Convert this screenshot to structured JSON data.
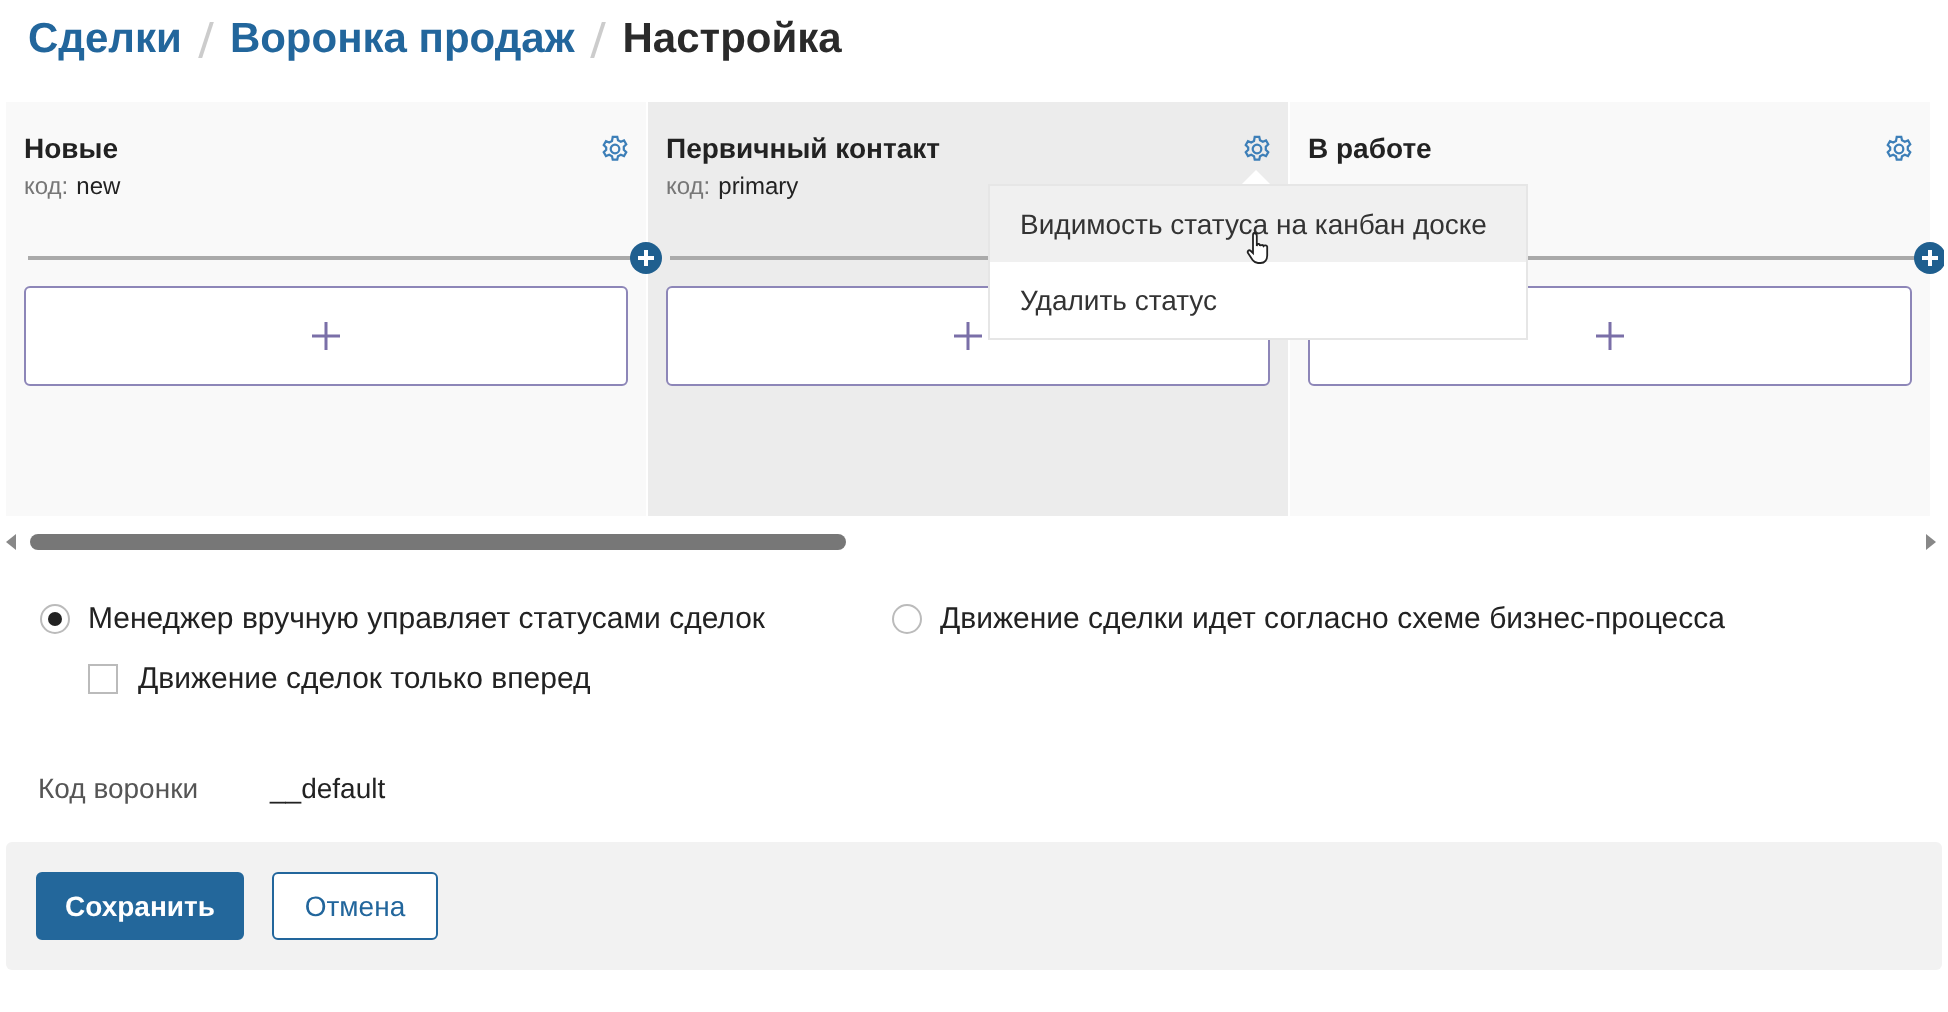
{
  "breadcrumb": [
    {
      "label": "Сделки",
      "kind": "link"
    },
    {
      "label": "Воронка продаж",
      "kind": "link"
    },
    {
      "label": "Настройка",
      "kind": "current"
    }
  ],
  "columns": [
    {
      "title": "Новые",
      "code_label": "код:",
      "code": "new",
      "highlighted": false
    },
    {
      "title": "Первичный контакт",
      "code_label": "код:",
      "code": "primary",
      "highlighted": true,
      "context_menu": {
        "items": [
          {
            "label": "Видимость статуса на канбан доске",
            "hovered": true
          },
          {
            "label": "Удалить статус",
            "hovered": false
          }
        ]
      }
    },
    {
      "title": "В работе",
      "highlighted": false
    }
  ],
  "mode_options": [
    {
      "label": "Менеджер вручную управляет статусами сделок",
      "selected": true
    },
    {
      "label": "Движение сделки идет согласно схеме бизнес-процесса",
      "selected": false
    }
  ],
  "forward_only": {
    "label": "Движение сделок только вперед",
    "checked": false
  },
  "funnel_code": {
    "label": "Код воронки",
    "value": "__default"
  },
  "buttons": [
    {
      "label": "Сохранить",
      "kind": "primary"
    },
    {
      "label": "Отмена",
      "kind": "secondary"
    }
  ]
}
